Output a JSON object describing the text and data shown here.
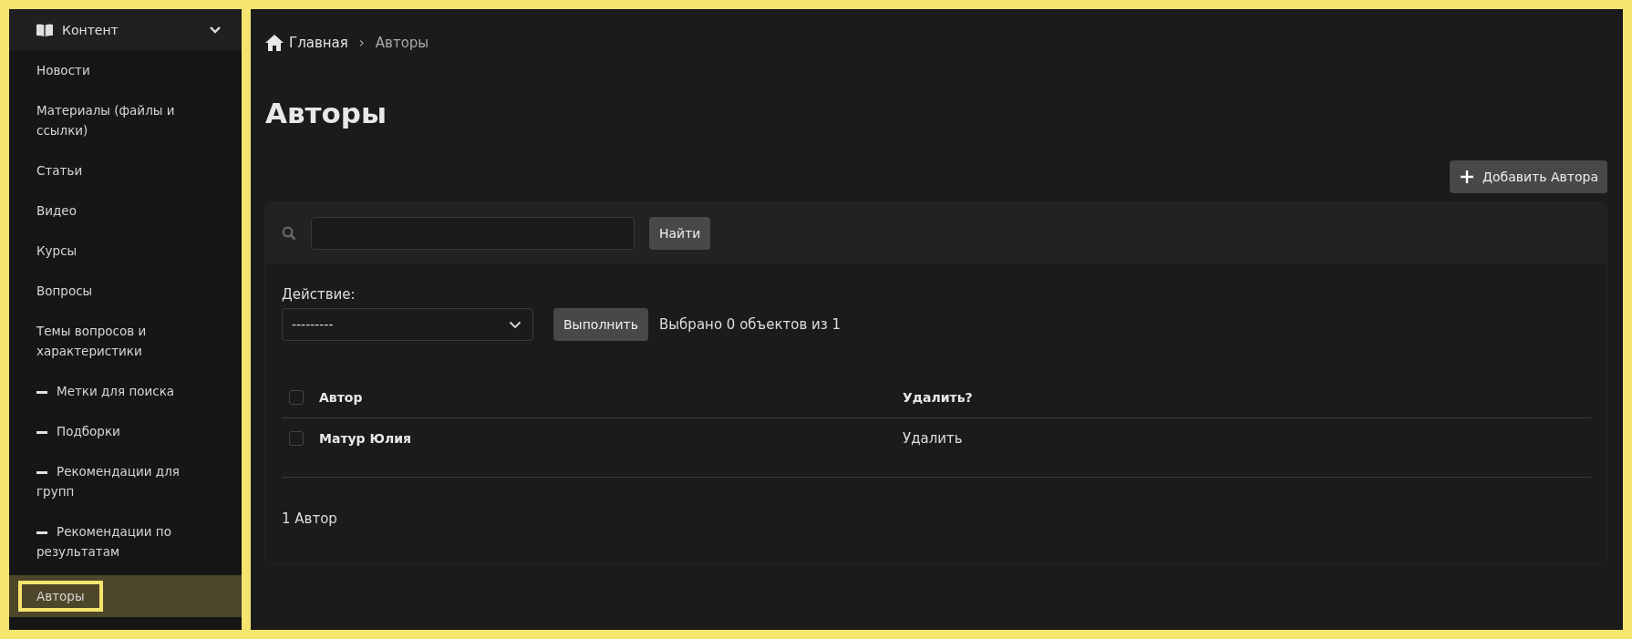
{
  "sidebar": {
    "section": {
      "label": "Контент",
      "expanded": true
    },
    "items": [
      {
        "label": "Новости",
        "kind": "link",
        "selected": false
      },
      {
        "label": "Материалы (файлы и ссылки)",
        "kind": "link",
        "selected": false
      },
      {
        "label": "Статьи",
        "kind": "link",
        "selected": false
      },
      {
        "label": "Видео",
        "kind": "link",
        "selected": false
      },
      {
        "label": "Курсы",
        "kind": "link",
        "selected": false
      },
      {
        "label": "Вопросы",
        "kind": "link",
        "selected": false
      },
      {
        "label": "Темы вопросов и характеристики",
        "kind": "link",
        "selected": false
      },
      {
        "label": "Метки для поиска",
        "kind": "sub",
        "selected": false
      },
      {
        "label": "Подборки",
        "kind": "sub",
        "selected": false
      },
      {
        "label": "Рекомендации для групп",
        "kind": "sub",
        "selected": false
      },
      {
        "label": "Рекомендации по результатам",
        "kind": "sub",
        "selected": false
      },
      {
        "label": "Авторы",
        "kind": "link",
        "selected": true
      }
    ]
  },
  "breadcrumbs": [
    "Главная",
    "Авторы"
  ],
  "breadcrumb_separator": "›",
  "title": "Авторы",
  "add_button": "Добавить Автора",
  "search": {
    "button": "Найти"
  },
  "actions": {
    "label": "Действие:",
    "select_value": "---------",
    "button": "Выполнить",
    "counter": "Выбрано 0 объектов из 1"
  },
  "table": {
    "columns": [
      {
        "label": "Автор"
      },
      {
        "label": "Удалить?"
      }
    ],
    "select_all_checked": false,
    "rows": [
      {
        "checked": false,
        "cells": [
          "Матур Юлия",
          "Удалить"
        ]
      }
    ]
  },
  "footer": "1 Автор"
}
